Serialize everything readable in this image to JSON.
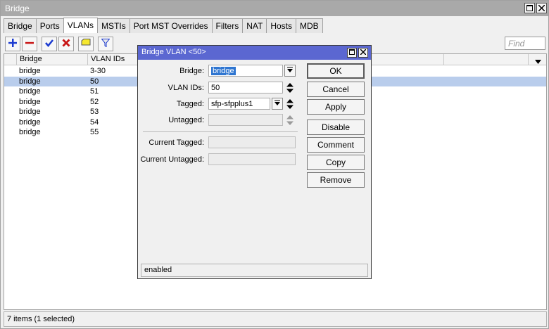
{
  "window": {
    "title": "Bridge"
  },
  "tabs": [
    "Bridge",
    "Ports",
    "VLANs",
    "MSTIs",
    "Port MST Overrides",
    "Filters",
    "NAT",
    "Hosts",
    "MDB"
  ],
  "active_tab": "VLANs",
  "toolbar": {
    "find_placeholder": "Find"
  },
  "table": {
    "columns": [
      "Bridge",
      "VLAN IDs"
    ],
    "rows": [
      {
        "bridge": "bridge",
        "vlan_ids": "3-30"
      },
      {
        "bridge": "bridge",
        "vlan_ids": "50"
      },
      {
        "bridge": "bridge",
        "vlan_ids": "51"
      },
      {
        "bridge": "bridge",
        "vlan_ids": "52"
      },
      {
        "bridge": "bridge",
        "vlan_ids": "53"
      },
      {
        "bridge": "bridge",
        "vlan_ids": "54"
      },
      {
        "bridge": "bridge",
        "vlan_ids": "55"
      }
    ],
    "selected_row": 1
  },
  "statusbar": {
    "text": "7 items (1 selected)"
  },
  "dialog": {
    "title": "Bridge VLAN <50>",
    "fields": {
      "bridge_label": "Bridge:",
      "bridge_value": "bridge",
      "vlan_ids_label": "VLAN IDs:",
      "vlan_ids_value": "50",
      "tagged_label": "Tagged:",
      "tagged_value": "sfp-sfpplus1",
      "untagged_label": "Untagged:",
      "untagged_value": "",
      "current_tagged_label": "Current Tagged:",
      "current_tagged_value": "",
      "current_untagged_label": "Current Untagged:",
      "current_untagged_value": ""
    },
    "buttons": {
      "ok": "OK",
      "cancel": "Cancel",
      "apply": "Apply",
      "disable": "Disable",
      "comment": "Comment",
      "copy": "Copy",
      "remove": "Remove"
    },
    "status": "enabled"
  },
  "colors": {
    "dialog_title_bg": "#5b67d1",
    "window_title_bg": "#a9a9a9",
    "selected_row_bg": "#b9cdec",
    "add_icon": "#1c3bd0",
    "remove_icon": "#c81414"
  }
}
